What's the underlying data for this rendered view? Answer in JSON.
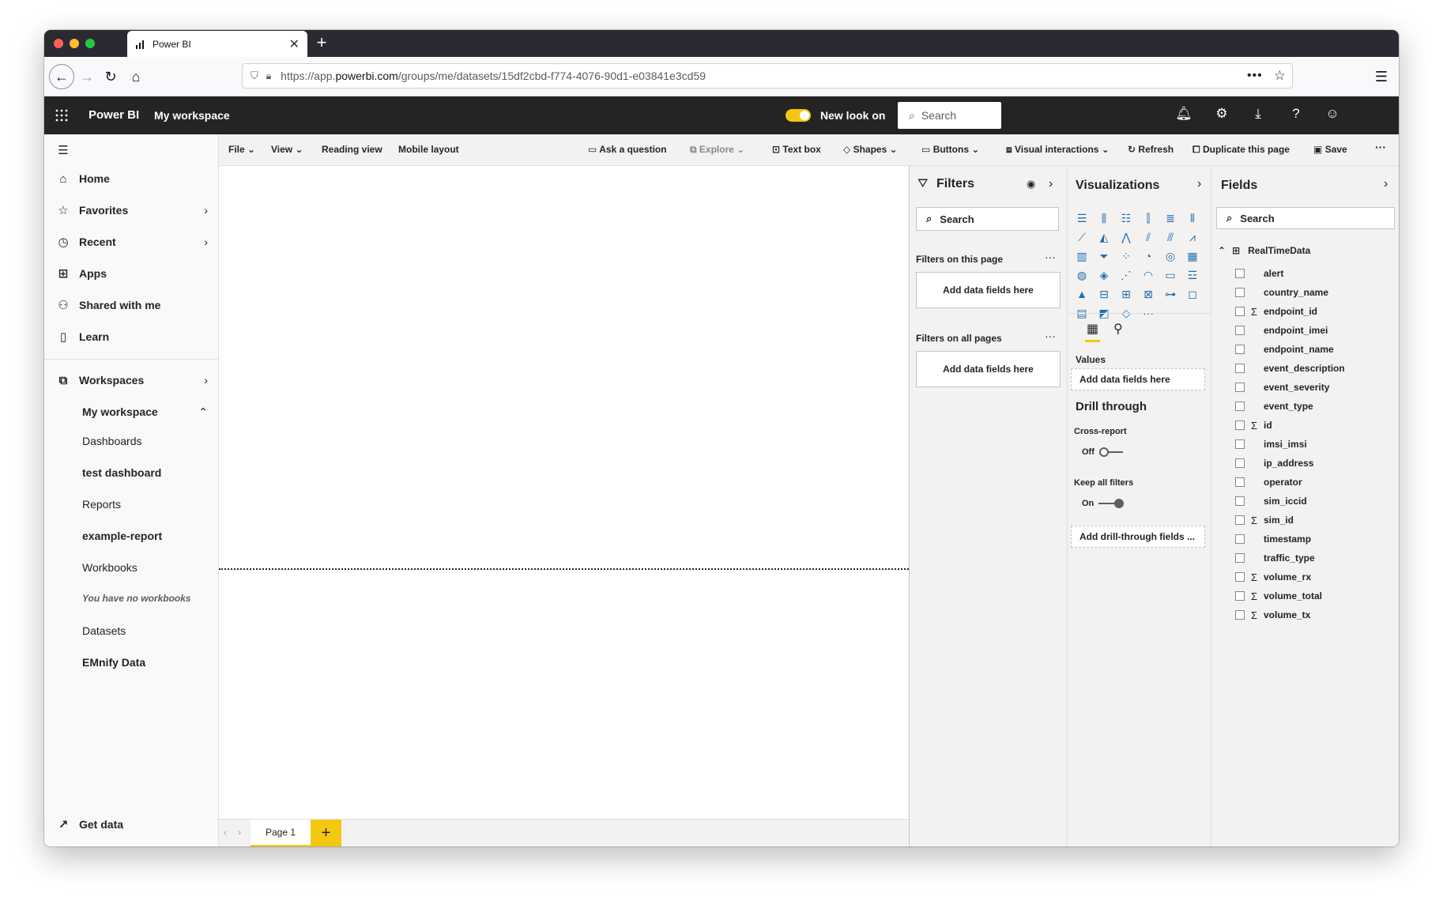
{
  "browser": {
    "tab_title": "Power BI",
    "url_prefix": "https://app.",
    "url_domain": "powerbi.com",
    "url_path": "/groups/me/datasets/15df2cbd-f774-4076-90d1-e03841e3cd59"
  },
  "header": {
    "brand": "Power BI",
    "workspace": "My workspace",
    "new_look": "New look on",
    "search_placeholder": "Search"
  },
  "nav": {
    "home": "Home",
    "favorites": "Favorites",
    "recent": "Recent",
    "apps": "Apps",
    "shared": "Shared with me",
    "learn": "Learn",
    "workspaces": "Workspaces",
    "my_workspace": "My workspace",
    "dashboards": "Dashboards",
    "test_dashboard": "test dashboard",
    "reports": "Reports",
    "example_report": "example-report",
    "workbooks": "Workbooks",
    "no_workbooks": "You have no workbooks",
    "datasets": "Datasets",
    "emnify": "EMnify Data",
    "get_data": "Get data"
  },
  "toolbar": {
    "file": "File",
    "view": "View",
    "reading_view": "Reading view",
    "mobile_layout": "Mobile layout",
    "ask": "Ask a question",
    "explore": "Explore",
    "text_box": "Text box",
    "shapes": "Shapes",
    "buttons": "Buttons",
    "visual_interactions": "Visual interactions",
    "refresh": "Refresh",
    "duplicate": "Duplicate this page",
    "save": "Save"
  },
  "pages": {
    "page1": "Page 1",
    "add": "+"
  },
  "filters": {
    "title": "Filters",
    "search": "Search",
    "on_this_page": "Filters on this page",
    "on_all_pages": "Filters on all pages",
    "add_fields": "Add data fields here"
  },
  "visualizations": {
    "title": "Visualizations",
    "values_label": "Values",
    "values_well": "Add data fields here",
    "drill_through": "Drill through",
    "cross_report": "Cross-report",
    "cross_report_state": "Off",
    "keep_filters": "Keep all filters",
    "keep_filters_state": "On",
    "drill_well": "Add drill-through fields ..."
  },
  "fields": {
    "title": "Fields",
    "search": "Search",
    "table": "RealTimeData",
    "items": [
      {
        "name": "alert",
        "sigma": ""
      },
      {
        "name": "country_name",
        "sigma": ""
      },
      {
        "name": "endpoint_id",
        "sigma": "Σ"
      },
      {
        "name": "endpoint_imei",
        "sigma": ""
      },
      {
        "name": "endpoint_name",
        "sigma": ""
      },
      {
        "name": "event_description",
        "sigma": ""
      },
      {
        "name": "event_severity",
        "sigma": ""
      },
      {
        "name": "event_type",
        "sigma": ""
      },
      {
        "name": "id",
        "sigma": "Σ"
      },
      {
        "name": "imsi_imsi",
        "sigma": ""
      },
      {
        "name": "ip_address",
        "sigma": ""
      },
      {
        "name": "operator",
        "sigma": ""
      },
      {
        "name": "sim_iccid",
        "sigma": ""
      },
      {
        "name": "sim_id",
        "sigma": "Σ"
      },
      {
        "name": "timestamp",
        "sigma": ""
      },
      {
        "name": "traffic_type",
        "sigma": ""
      },
      {
        "name": "volume_rx",
        "sigma": "Σ"
      },
      {
        "name": "volume_total",
        "sigma": "Σ"
      },
      {
        "name": "volume_tx",
        "sigma": "Σ"
      }
    ]
  },
  "colors": {
    "accent": "#f2c811",
    "header_bg": "#252423",
    "viz_icon": "#1f6fb5"
  }
}
